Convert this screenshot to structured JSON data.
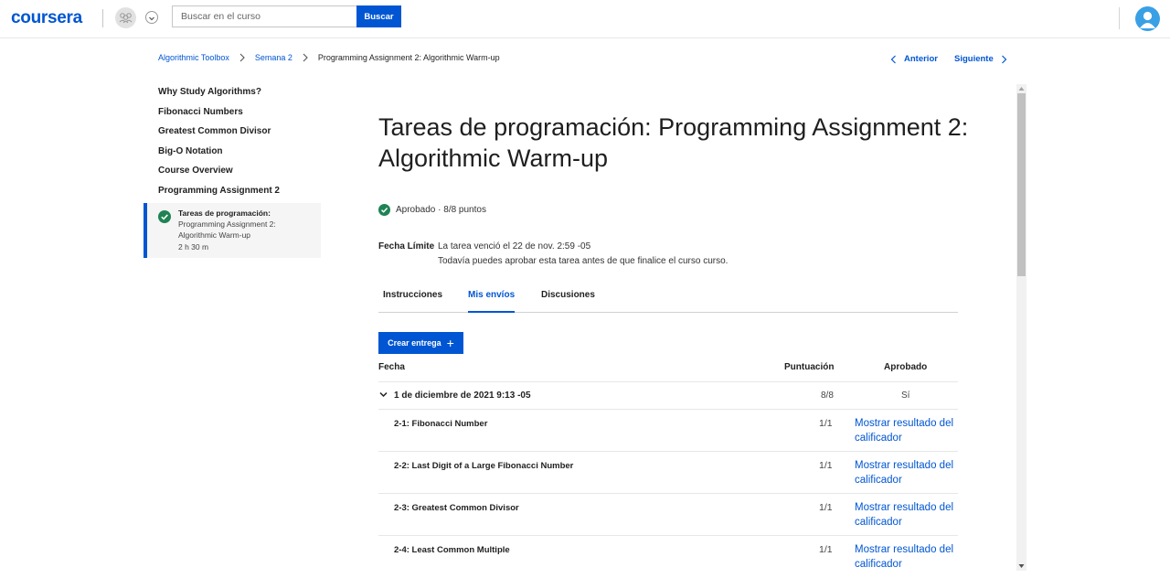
{
  "header": {
    "logo": "coursera",
    "search_placeholder": "Buscar en el curso",
    "search_button": "Buscar"
  },
  "breadcrumb": {
    "course": "Algorithmic Toolbox",
    "week": "Semana 2",
    "current": "Programming Assignment 2: Algorithmic Warm-up"
  },
  "nav": {
    "prev": "Anterior",
    "next": "Siguiente"
  },
  "sidebar": {
    "items": [
      {
        "label": "Why Study Algorithms?"
      },
      {
        "label": "Fibonacci Numbers"
      },
      {
        "label": "Greatest Common Divisor"
      },
      {
        "label": "Big-O Notation"
      },
      {
        "label": "Course Overview"
      },
      {
        "label": "Programming Assignment 2"
      }
    ],
    "active": {
      "title": "Tareas de programación:",
      "subtitle_1": "Programming Assignment 2:",
      "subtitle_2": "Algorithmic Warm-up",
      "duration": "2 h 30 m"
    }
  },
  "main": {
    "title": "Tareas de programación: Programming Assignment 2: Algorithmic Warm-up",
    "status": "Aprobado · 8/8 puntos",
    "due_label": "Fecha Límite",
    "due_line1": "La tarea venció el 22 de nov. 2:59 -05",
    "due_line2": "Todavía puedes aprobar esta tarea antes de que finalice el curso curso.",
    "tabs": [
      {
        "label": "Instrucciones"
      },
      {
        "label": "Mis envíos"
      },
      {
        "label": "Discusiones"
      }
    ],
    "create_button": "Crear entrega",
    "table": {
      "headers": {
        "date": "Fecha",
        "score": "Puntuación",
        "passed": "Aprobado"
      },
      "submission": {
        "date": "1 de diciembre de 2021 9:13 -05",
        "score": "8/8",
        "passed": "Sí"
      },
      "parts": [
        {
          "name": "2-1: Fibonacci Number",
          "score": "1/1",
          "link": "Mostrar resultado del calificador"
        },
        {
          "name": "2-2: Last Digit of a Large Fibonacci Number",
          "score": "1/1",
          "link": "Mostrar resultado del calificador"
        },
        {
          "name": "2-3: Greatest Common Divisor",
          "score": "1/1",
          "link": "Mostrar resultado del calificador"
        },
        {
          "name": "2-4: Least Common Multiple",
          "score": "1/1",
          "link": "Mostrar resultado del calificador"
        }
      ]
    }
  },
  "colors": {
    "brand": "#0056d2",
    "success": "#1f8354"
  }
}
